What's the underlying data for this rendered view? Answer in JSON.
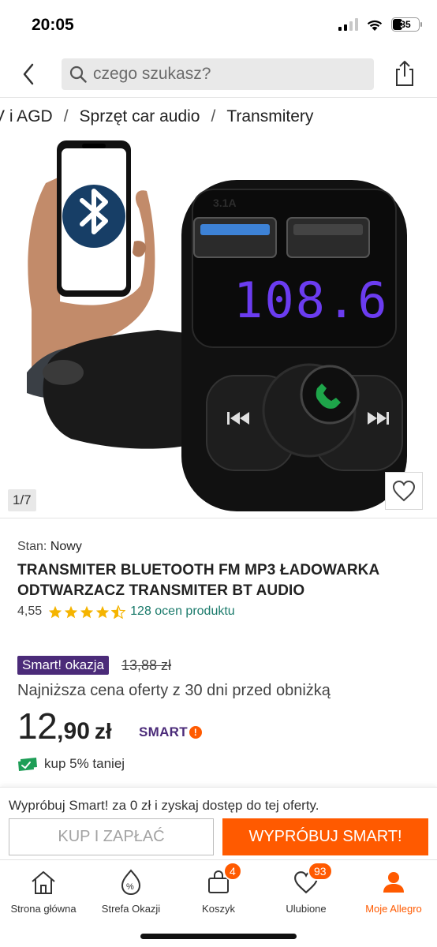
{
  "status": {
    "time": "20:05",
    "battery": "35"
  },
  "header": {
    "search_placeholder": "czego szukasz?"
  },
  "breadcrumb": [
    "V i AGD",
    "Sprzęt car audio",
    "Transmitery"
  ],
  "gallery": {
    "counter": "1/7",
    "device_display": "108.6",
    "port_a_label": "3.1A"
  },
  "product": {
    "condition_label": "Stan:",
    "condition_value": "Nowy",
    "title": "TRANSMITER BLUETOOTH FM MP3 ŁADOWARKA ODTWARZACZ TRANSMITER BT AUDIO",
    "rating": "4,55",
    "rating_value": 4.55,
    "reviews": "128 ocen produktu"
  },
  "pricing": {
    "promo_badge": "Smart! okazja",
    "old_price": "13,88 zł",
    "lowest_note": "Najniższa cena oferty z 30 dni przed obniżką",
    "price_int": "12",
    "price_dec": ",90",
    "currency": "zł",
    "smart_logo": "SMART",
    "discount_text": "kup 5% taniej"
  },
  "cta": {
    "text": "Wypróbuj Smart! za 0 zł i zyskaj dostęp do tej oferty.",
    "buy_label": "KUP I ZAPŁAĆ",
    "try_label": "WYPRÓBUJ SMART!"
  },
  "nav": {
    "items": [
      {
        "label": "Strona główna",
        "icon": "home-icon"
      },
      {
        "label": "Strefa Okazji",
        "icon": "percent-tag-icon"
      },
      {
        "label": "Koszyk",
        "icon": "cart-icon",
        "badge": "4"
      },
      {
        "label": "Ulubione",
        "icon": "heart-icon",
        "badge": "93"
      },
      {
        "label": "Moje Allegro",
        "icon": "user-icon",
        "active": true
      }
    ]
  },
  "colors": {
    "accent": "#ff5a00",
    "smart_purple": "#4b2b79",
    "link_teal": "#1a7a6b",
    "star": "#f5b400"
  }
}
